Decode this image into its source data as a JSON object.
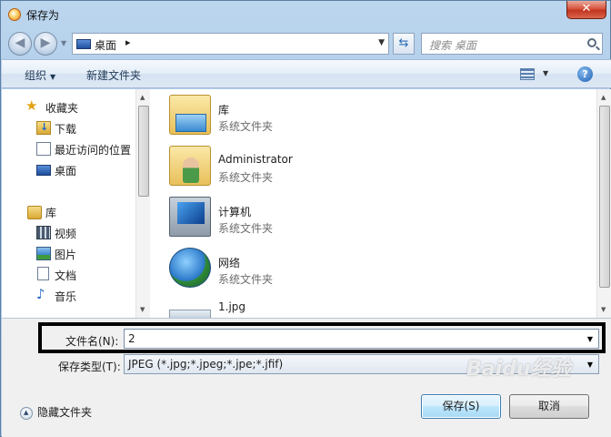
{
  "window": {
    "title": "保存为",
    "close_label": "✕"
  },
  "address": {
    "location": "桌面",
    "separator": "▸"
  },
  "search": {
    "placeholder": "搜索 桌面"
  },
  "toolbar": {
    "organize_label": "组织",
    "new_folder_label": "新建文件夹"
  },
  "sidebar": {
    "items": [
      {
        "label": "收藏夹",
        "icon": "star-icon"
      },
      {
        "label": "下载",
        "icon": "downloads-folder-icon"
      },
      {
        "label": "最近访问的位置",
        "icon": "recent-places-icon"
      },
      {
        "label": "桌面",
        "icon": "desktop-icon"
      },
      {
        "label": "库",
        "icon": "library-icon"
      },
      {
        "label": "视频",
        "icon": "video-icon"
      },
      {
        "label": "图片",
        "icon": "pictures-icon"
      },
      {
        "label": "文档",
        "icon": "documents-icon"
      },
      {
        "label": "音乐",
        "icon": "music-icon"
      }
    ]
  },
  "files": [
    {
      "name": "库",
      "type": "系统文件夹",
      "icon": "library-folder-icon"
    },
    {
      "name": "Administrator",
      "type": "系统文件夹",
      "icon": "user-folder-icon"
    },
    {
      "name": "计算机",
      "type": "系统文件夹",
      "icon": "computer-icon"
    },
    {
      "name": "网络",
      "type": "系统文件夹",
      "icon": "network-icon"
    },
    {
      "name": "1.jpg",
      "type": "",
      "icon": "image-file-icon"
    }
  ],
  "form": {
    "filename_label": "文件名(N):",
    "filename_value": "2",
    "filetype_label": "保存类型(T):",
    "filetype_value": "JPEG (*.jpg;*.jpeg;*.jpe;*.jfif)",
    "hide_folders_label": "隐藏文件夹",
    "save_label": "保存(S)",
    "cancel_label": "取消"
  },
  "watermark": {
    "text": "Baidu经验"
  },
  "colors": {
    "accent": "#3c7fb1",
    "highlight_border": "#000000"
  }
}
